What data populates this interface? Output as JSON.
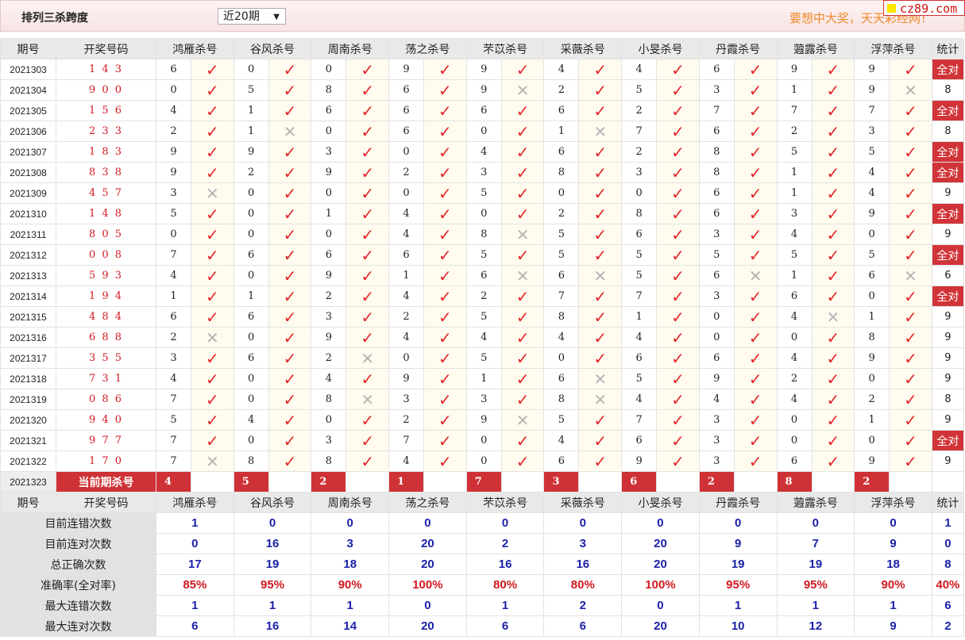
{
  "header": {
    "title": "排列三杀跨度",
    "period_select": "近20期",
    "slogan": "要想中大奖，天天彩经网！",
    "logo": "cz89.com"
  },
  "columns": {
    "issue": "期号",
    "draw": "开奖号码",
    "experts": [
      "鸿雁杀号",
      "谷风杀号",
      "周南杀号",
      "荡之杀号",
      "芣苡杀号",
      "采薇杀号",
      "小旻杀号",
      "丹霞杀号",
      "蕸露杀号",
      "浮萍杀号"
    ],
    "stat": "统计"
  },
  "rows": [
    {
      "issue": "2021303",
      "draw": "1 4 3",
      "kills": [
        "6",
        "0",
        "0",
        "9",
        "9",
        "4",
        "4",
        "6",
        "9",
        "9"
      ],
      "hits": "1111111111",
      "stat": "全对"
    },
    {
      "issue": "2021304",
      "draw": "9 0 0",
      "kills": [
        "0",
        "5",
        "8",
        "6",
        "9",
        "2",
        "5",
        "3",
        "1",
        "9"
      ],
      "hits": "1111011110",
      "stat": "8"
    },
    {
      "issue": "2021305",
      "draw": "1 5 6",
      "kills": [
        "4",
        "1",
        "6",
        "6",
        "6",
        "6",
        "2",
        "7",
        "7",
        "7"
      ],
      "hits": "1111111111",
      "stat": "全对"
    },
    {
      "issue": "2021306",
      "draw": "2 3 3",
      "kills": [
        "2",
        "1",
        "0",
        "6",
        "0",
        "1",
        "7",
        "6",
        "2",
        "3"
      ],
      "hits": "1011101111",
      "stat": "8"
    },
    {
      "issue": "2021307",
      "draw": "1 8 3",
      "kills": [
        "9",
        "9",
        "3",
        "0",
        "4",
        "6",
        "2",
        "8",
        "5",
        "5"
      ],
      "hits": "1111111111",
      "stat": "全对"
    },
    {
      "issue": "2021308",
      "draw": "8 3 8",
      "kills": [
        "9",
        "2",
        "9",
        "2",
        "3",
        "8",
        "3",
        "8",
        "1",
        "4"
      ],
      "hits": "1111111111",
      "stat": "全对"
    },
    {
      "issue": "2021309",
      "draw": "4 5 7",
      "kills": [
        "3",
        "0",
        "0",
        "0",
        "5",
        "0",
        "0",
        "6",
        "1",
        "4"
      ],
      "hits": "0111111111",
      "stat": "9"
    },
    {
      "issue": "2021310",
      "draw": "1 4 8",
      "kills": [
        "5",
        "0",
        "1",
        "4",
        "0",
        "2",
        "8",
        "6",
        "3",
        "9"
      ],
      "hits": "1111111111",
      "stat": "全对"
    },
    {
      "issue": "2021311",
      "draw": "8 0 5",
      "kills": [
        "0",
        "0",
        "0",
        "4",
        "8",
        "5",
        "6",
        "3",
        "4",
        "0"
      ],
      "hits": "1111011111",
      "stat": "9"
    },
    {
      "issue": "2021312",
      "draw": "0 0 8",
      "kills": [
        "7",
        "6",
        "6",
        "6",
        "5",
        "5",
        "5",
        "5",
        "5",
        "5"
      ],
      "hits": "1111111111",
      "stat": "全对"
    },
    {
      "issue": "2021313",
      "draw": "5 9 3",
      "kills": [
        "4",
        "0",
        "9",
        "1",
        "6",
        "6",
        "5",
        "6",
        "1",
        "6"
      ],
      "hits": "1111001010",
      "stat": "6"
    },
    {
      "issue": "2021314",
      "draw": "1 9 4",
      "kills": [
        "1",
        "1",
        "2",
        "4",
        "2",
        "7",
        "7",
        "3",
        "6",
        "0"
      ],
      "hits": "1111111111",
      "stat": "全对"
    },
    {
      "issue": "2021315",
      "draw": "4 8 4",
      "kills": [
        "6",
        "6",
        "3",
        "2",
        "5",
        "8",
        "1",
        "0",
        "4",
        "1"
      ],
      "hits": "1111111101",
      "stat": "9"
    },
    {
      "issue": "2021316",
      "draw": "6 8 8",
      "kills": [
        "2",
        "0",
        "9",
        "4",
        "4",
        "4",
        "4",
        "0",
        "0",
        "8"
      ],
      "hits": "0111111111",
      "stat": "9"
    },
    {
      "issue": "2021317",
      "draw": "3 5 5",
      "kills": [
        "3",
        "6",
        "2",
        "0",
        "5",
        "0",
        "6",
        "6",
        "4",
        "9"
      ],
      "hits": "1101111111",
      "stat": "9"
    },
    {
      "issue": "2021318",
      "draw": "7 3 1",
      "kills": [
        "4",
        "0",
        "4",
        "9",
        "1",
        "6",
        "5",
        "9",
        "2",
        "0"
      ],
      "hits": "1111101111",
      "stat": "9"
    },
    {
      "issue": "2021319",
      "draw": "0 8 6",
      "kills": [
        "7",
        "0",
        "8",
        "3",
        "3",
        "8",
        "4",
        "4",
        "4",
        "2"
      ],
      "hits": "1101101111",
      "stat": "8"
    },
    {
      "issue": "2021320",
      "draw": "9 4 0",
      "kills": [
        "5",
        "4",
        "0",
        "2",
        "9",
        "5",
        "7",
        "3",
        "0",
        "1"
      ],
      "hits": "1111011111",
      "stat": "9"
    },
    {
      "issue": "2021321",
      "draw": "9 7 7",
      "kills": [
        "7",
        "0",
        "3",
        "7",
        "0",
        "4",
        "6",
        "3",
        "0",
        "0"
      ],
      "hits": "1111111111",
      "stat": "全对"
    },
    {
      "issue": "2021322",
      "draw": "1 7 0",
      "kills": [
        "7",
        "8",
        "8",
        "4",
        "0",
        "6",
        "9",
        "3",
        "6",
        "9"
      ],
      "hits": "0111111111",
      "stat": "9"
    }
  ],
  "current": {
    "issue": "2021323",
    "label": "当前期杀号",
    "kills": [
      "4",
      "5",
      "2",
      "1",
      "7",
      "3",
      "6",
      "2",
      "8",
      "2"
    ]
  },
  "stats": [
    {
      "label": "目前连错次数",
      "values": [
        "1",
        "0",
        "0",
        "0",
        "0",
        "0",
        "0",
        "0",
        "0",
        "0"
      ],
      "stat": "1",
      "kind": "n"
    },
    {
      "label": "目前连对次数",
      "values": [
        "0",
        "16",
        "3",
        "20",
        "2",
        "3",
        "20",
        "9",
        "7",
        "9"
      ],
      "stat": "0",
      "kind": "n"
    },
    {
      "label": "总正确次数",
      "values": [
        "17",
        "19",
        "18",
        "20",
        "16",
        "16",
        "20",
        "19",
        "19",
        "18"
      ],
      "stat": "8",
      "kind": "n"
    },
    {
      "label": "准确率(全对率)",
      "values": [
        "85%",
        "95%",
        "90%",
        "100%",
        "80%",
        "80%",
        "100%",
        "95%",
        "95%",
        "90%"
      ],
      "stat": "40%",
      "kind": "p"
    },
    {
      "label": "最大连错次数",
      "values": [
        "1",
        "1",
        "1",
        "0",
        "1",
        "2",
        "0",
        "1",
        "1",
        "1"
      ],
      "stat": "6",
      "kind": "n"
    },
    {
      "label": "最大连对次数",
      "values": [
        "6",
        "16",
        "14",
        "20",
        "6",
        "6",
        "20",
        "10",
        "12",
        "9"
      ],
      "stat": "2",
      "kind": "n"
    }
  ],
  "colors": {
    "accent": "#d13438",
    "check": "#e3262b",
    "stat_value": "#1b21a8"
  }
}
